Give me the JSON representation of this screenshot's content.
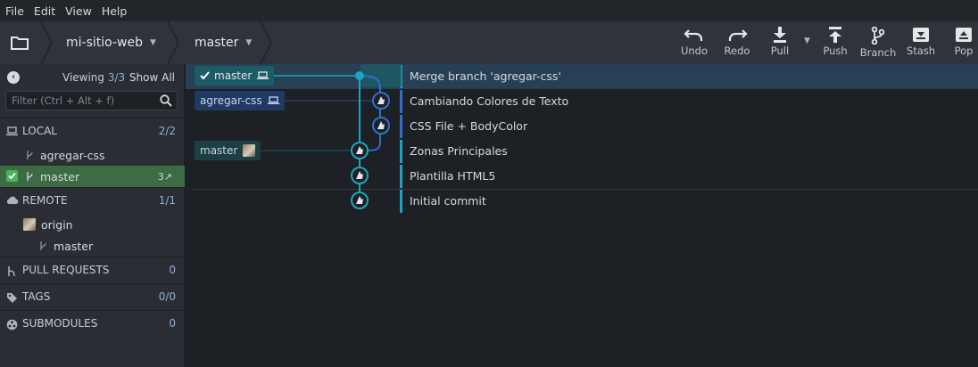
{
  "menu": [
    "File",
    "Edit",
    "View",
    "Help"
  ],
  "toolbar": {
    "repo": "mi-sitio-web",
    "branch": "master",
    "buttons": [
      {
        "label": "Undo",
        "icon": "undo-icon"
      },
      {
        "label": "Redo",
        "icon": "redo-icon"
      },
      {
        "label": "Pull",
        "icon": "pull-icon"
      },
      {
        "label": "Push",
        "icon": "push-icon"
      },
      {
        "label": "Branch",
        "icon": "branch-icon"
      },
      {
        "label": "Stash",
        "icon": "stash-icon"
      },
      {
        "label": "Pop",
        "icon": "pop-icon"
      }
    ]
  },
  "left": {
    "viewing_label": "Viewing",
    "viewing_count": "3/3",
    "show_all": "Show All",
    "filter_placeholder": "Filter (Ctrl + Alt + f)",
    "local": {
      "title": "LOCAL",
      "count": "2/2",
      "branches": [
        "agregar-css",
        "master"
      ],
      "active_ahead": "3↗"
    },
    "remote": {
      "title": "REMOTE",
      "count": "1/1",
      "origin": "origin",
      "branches": [
        "master"
      ]
    },
    "pull_requests": {
      "title": "PULL REQUESTS",
      "count": "0"
    },
    "tags": {
      "title": "TAGS",
      "count": "0/0"
    },
    "submodules": {
      "title": "SUBMODULES",
      "count": "0"
    }
  },
  "graph": {
    "commits": [
      {
        "message": "Merge branch 'agregar-css'"
      },
      {
        "message": "Cambiando Colores de Texto"
      },
      {
        "message": "CSS File + BodyColor"
      },
      {
        "message": "Zonas Principales"
      },
      {
        "message": "Plantilla HTML5"
      },
      {
        "message": "Initial commit"
      }
    ],
    "refs": {
      "head": "master",
      "feature": "agregar-css",
      "remote": "master"
    }
  },
  "colors": {
    "accent_teal": "#1ba6bf",
    "accent_blue": "#2f6fcf",
    "selection": "#274055",
    "active_branch": "#3c6b44"
  }
}
